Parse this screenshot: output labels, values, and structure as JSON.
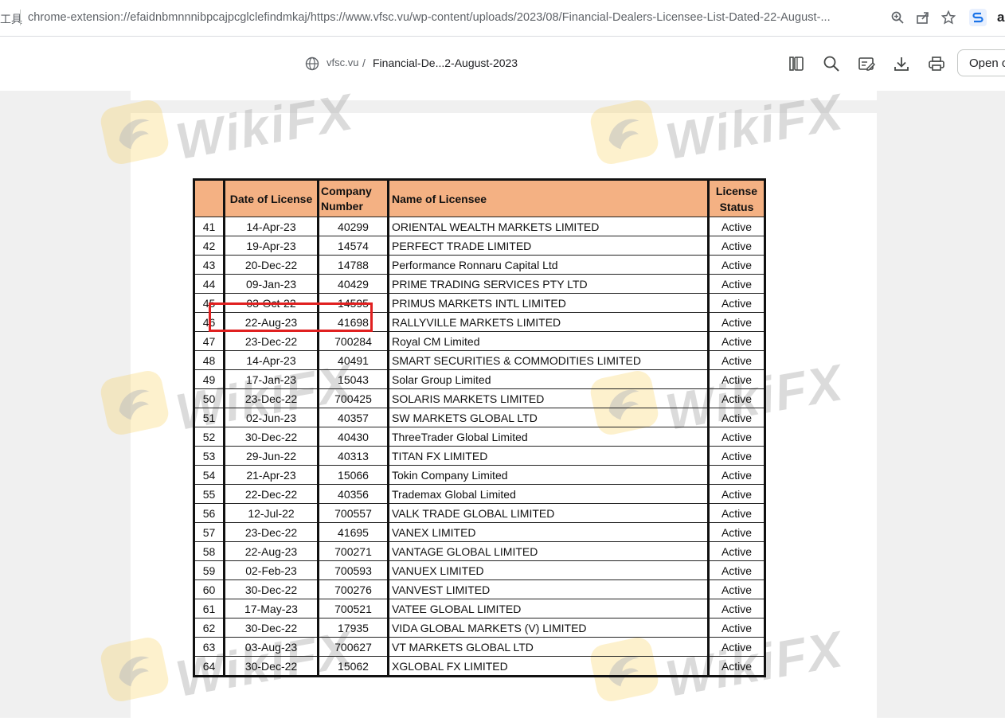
{
  "browser": {
    "prefix_text": "工具",
    "url": "chrome-extension://efaidnbmnnnibpcajpcglclefindmkaj/https://www.vfsc.vu/wp-content/uploads/2023/08/Financial-Dealers-Licensee-List-Dated-22-August-...",
    "zoom_icon": "zoom-icon",
    "share_icon": "share-icon",
    "bookmark_icon": "star-icon",
    "extension_icon": "extension-s-icon",
    "extension_letter": "a"
  },
  "pdf_toolbar": {
    "site": "vfsc.vu",
    "separator": "/",
    "document_name": "Financial-De...2-August-2023",
    "icons": [
      "panel-icon",
      "search-icon",
      "annotate-icon",
      "download-icon",
      "print-icon"
    ],
    "open_button_label": "Open o"
  },
  "watermark": {
    "text": "WikiFX"
  },
  "table": {
    "headers": {
      "no": "",
      "date": "Date of License",
      "company_line1": "Company",
      "company_line2": "Number",
      "name": "Name of Licensee",
      "status_line1": "License",
      "status_line2": "Status"
    },
    "header_color": "#f4b183",
    "rows": [
      {
        "no": "41",
        "date": "14-Apr-23",
        "company": "40299",
        "name": "ORIENTAL WEALTH MARKETS LIMITED",
        "status": "Active"
      },
      {
        "no": "42",
        "date": "19-Apr-23",
        "company": "14574",
        "name": "PERFECT TRADE LIMITED",
        "status": "Active"
      },
      {
        "no": "43",
        "date": "20-Dec-22",
        "company": "14788",
        "name": "Performance Ronnaru Capital Ltd",
        "status": "Active"
      },
      {
        "no": "44",
        "date": "09-Jan-23",
        "company": "40429",
        "name": "PRIME TRADING SERVICES PTY LTD",
        "status": "Active"
      },
      {
        "no": "45",
        "date": "03-Oct-22",
        "company": "14595",
        "name": "PRIMUS MARKETS INTL LIMITED",
        "status": "Active"
      },
      {
        "no": "46",
        "date": "22-Aug-23",
        "company": "41698",
        "name": "RALLYVILLE MARKETS LIMITED",
        "status": "Active"
      },
      {
        "no": "47",
        "date": "23-Dec-22",
        "company": "700284",
        "name": "Royal CM Limited",
        "status": "Active"
      },
      {
        "no": "48",
        "date": "14-Apr-23",
        "company": "40491",
        "name": "SMART SECURITIES & COMMODITIES LIMITED",
        "status": "Active"
      },
      {
        "no": "49",
        "date": "17-Jan-23",
        "company": "15043",
        "name": "Solar Group Limited",
        "status": "Active"
      },
      {
        "no": "50",
        "date": "23-Dec-22",
        "company": "700425",
        "name": "SOLARIS MARKETS LIMITED",
        "status": "Active"
      },
      {
        "no": "51",
        "date": "02-Jun-23",
        "company": "40357",
        "name": "SW MARKETS GLOBAL LTD",
        "status": "Active"
      },
      {
        "no": "52",
        "date": "30-Dec-22",
        "company": "40430",
        "name": "ThreeTrader Global Limited",
        "status": "Active"
      },
      {
        "no": "53",
        "date": "29-Jun-22",
        "company": "40313",
        "name": "TITAN FX LIMITED",
        "status": "Active"
      },
      {
        "no": "54",
        "date": "21-Apr-23",
        "company": "15066",
        "name": "Tokin Company Limited",
        "status": "Active"
      },
      {
        "no": "55",
        "date": "22-Dec-22",
        "company": "40356",
        "name": "Trademax Global Limited",
        "status": "Active"
      },
      {
        "no": "56",
        "date": "12-Jul-22",
        "company": "700557",
        "name": "VALK TRADE GLOBAL LIMITED",
        "status": "Active"
      },
      {
        "no": "57",
        "date": "23-Dec-22",
        "company": "41695",
        "name": "VANEX LIMITED",
        "status": "Active"
      },
      {
        "no": "58",
        "date": "22-Aug-23",
        "company": "700271",
        "name": "VANTAGE GLOBAL LIMITED",
        "status": "Active"
      },
      {
        "no": "59",
        "date": "02-Feb-23",
        "company": "700593",
        "name": "VANUEX LIMITED",
        "status": "Active"
      },
      {
        "no": "60",
        "date": "30-Dec-22",
        "company": "700276",
        "name": "VANVEST LIMITED",
        "status": "Active"
      },
      {
        "no": "61",
        "date": "17-May-23",
        "company": "700521",
        "name": "VATEE GLOBAL LIMITED",
        "status": "Active"
      },
      {
        "no": "62",
        "date": "30-Dec-22",
        "company": "17935",
        "name": "VIDA GLOBAL MARKETS (V) LIMITED",
        "status": "Active"
      },
      {
        "no": "63",
        "date": "03-Aug-23",
        "company": "700627",
        "name": "VT MARKETS GLOBAL LTD",
        "status": "Active"
      },
      {
        "no": "64",
        "date": "30-Dec-22",
        "company": "15062",
        "name": "XGLOBAL FX LIMITED",
        "status": "Active"
      }
    ]
  },
  "highlight": {
    "color": "#e02020",
    "row_no": "46"
  }
}
